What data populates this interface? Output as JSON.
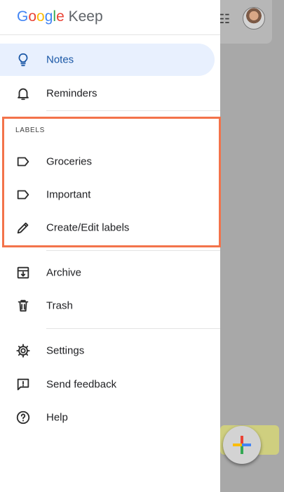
{
  "app": {
    "logo_text": "Google",
    "product_name": "Keep",
    "logo_colors": [
      "#4285F4",
      "#EA4335",
      "#FBBC05",
      "#4285F4",
      "#34A853",
      "#EA4335"
    ],
    "brand_accent": "#1a73e8"
  },
  "nav": {
    "notes": "Notes",
    "reminders": "Reminders",
    "labels_heading": "LABELS",
    "labels": [
      "Groceries",
      "Important"
    ],
    "create_edit": "Create/Edit labels",
    "archive": "Archive",
    "trash": "Trash",
    "settings": "Settings",
    "send_feedback": "Send feedback",
    "help": "Help"
  },
  "icons": {
    "notes": "lightbulb-icon",
    "reminders": "bell-icon",
    "label": "label-icon",
    "create_edit": "pencil-icon",
    "archive": "archive-icon",
    "trash": "trash-icon",
    "settings": "gear-icon",
    "send_feedback": "feedback-icon",
    "help": "help-icon",
    "grid": "grid-icon",
    "new_note": "plus-icon"
  },
  "highlight_color": "#f3734b"
}
